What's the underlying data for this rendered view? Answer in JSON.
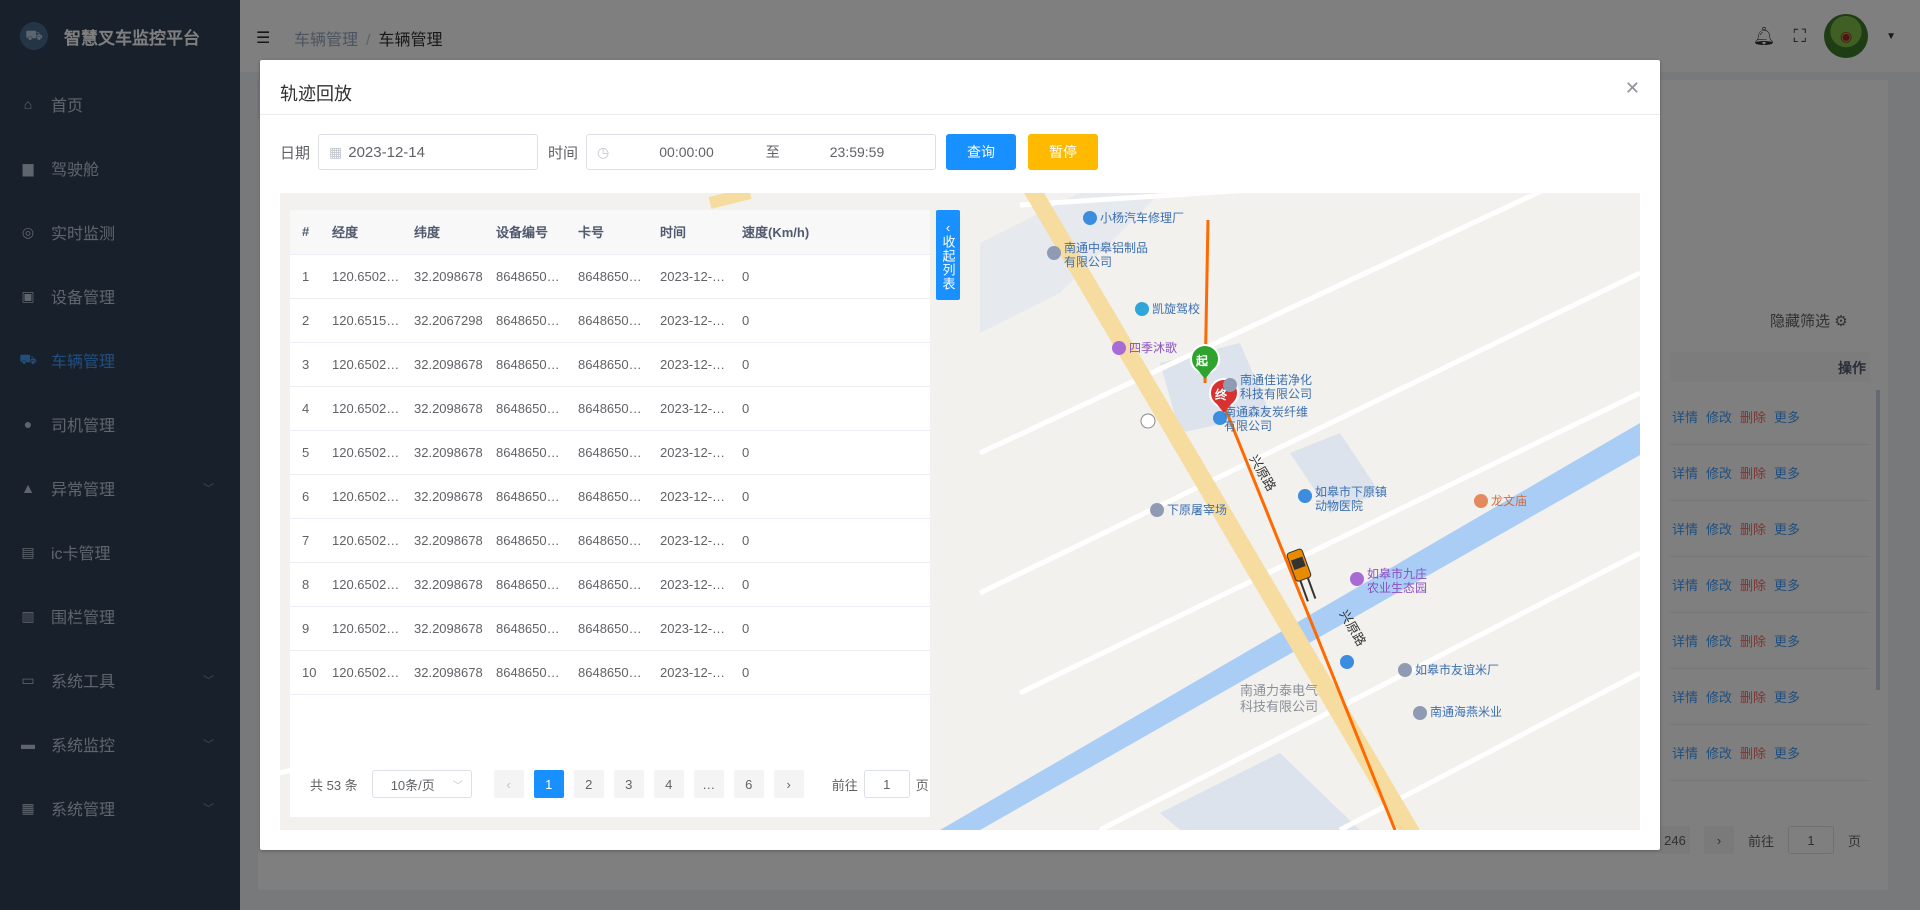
{
  "app": {
    "title": "智慧叉车监控平台"
  },
  "sidebar": {
    "items": [
      {
        "label": "首页",
        "icon": "home-icon"
      },
      {
        "label": "驾驶舱",
        "icon": "monitor-icon"
      },
      {
        "label": "实时监测",
        "icon": "target-icon"
      },
      {
        "label": "设备管理",
        "icon": "image-icon"
      },
      {
        "label": "车辆管理",
        "icon": "truck-icon",
        "active": true
      },
      {
        "label": "司机管理",
        "icon": "user-icon"
      },
      {
        "label": "异常管理",
        "icon": "warning-icon",
        "expandable": true
      },
      {
        "label": "ic卡管理",
        "icon": "card-icon"
      },
      {
        "label": "围栏管理",
        "icon": "fence-icon"
      },
      {
        "label": "系统工具",
        "icon": "toolbox-icon",
        "expandable": true
      },
      {
        "label": "系统监控",
        "icon": "screen-icon",
        "expandable": true
      },
      {
        "label": "系统管理",
        "icon": "grid-icon",
        "expandable": true
      }
    ]
  },
  "header": {
    "breadcrumb": [
      "车辆管理",
      "车辆管理"
    ]
  },
  "background": {
    "hide_filter": "隐藏筛选",
    "op_header": "操作",
    "row_actions": {
      "detail": "详情",
      "edit": "修改",
      "delete": "删除",
      "more": "更多"
    },
    "pager": {
      "last_page": "246",
      "goto_prefix": "前往",
      "goto_value": "1",
      "goto_suffix": "页"
    }
  },
  "dialog": {
    "title": "轨迹回放",
    "query": {
      "date_label": "日期",
      "date_value": "2023-12-14",
      "time_label": "时间",
      "time_start": "00:00:00",
      "time_sep": "至",
      "time_end": "23:59:59",
      "search_button": "查询",
      "pause_button": "暂停"
    },
    "table": {
      "columns": [
        "#",
        "经度",
        "纬度",
        "设备编号",
        "卡号",
        "时间",
        "速度(Km/h)"
      ],
      "rows": [
        [
          "1",
          "120.6502…",
          "32.2098678",
          "86486506…",
          "86486506…",
          "2023-12-1…",
          "0"
        ],
        [
          "2",
          "120.6515…",
          "32.2067298",
          "86486506…",
          "86486506…",
          "2023-12-1…",
          "0"
        ],
        [
          "3",
          "120.6502…",
          "32.2098678",
          "86486506…",
          "86486506…",
          "2023-12-1…",
          "0"
        ],
        [
          "4",
          "120.6502…",
          "32.2098678",
          "86486506…",
          "86486506…",
          "2023-12-1…",
          "0"
        ],
        [
          "5",
          "120.6502…",
          "32.2098678",
          "86486506…",
          "86486506…",
          "2023-12-1…",
          "0"
        ],
        [
          "6",
          "120.6502…",
          "32.2098678",
          "86486506…",
          "86486506…",
          "2023-12-1…",
          "0"
        ],
        [
          "7",
          "120.6502…",
          "32.2098678",
          "86486506…",
          "86486506…",
          "2023-12-1…",
          "0"
        ],
        [
          "8",
          "120.6502…",
          "32.2098678",
          "86486506…",
          "86486506…",
          "2023-12-1…",
          "0"
        ],
        [
          "9",
          "120.6502…",
          "32.2098678",
          "86486506…",
          "86486506…",
          "2023-12-1…",
          "0"
        ],
        [
          "10",
          "120.6502…",
          "32.2098678",
          "86486506…",
          "86486506…",
          "2023-12-1…",
          "0"
        ]
      ]
    },
    "pager": {
      "total": "共 53 条",
      "page_size": "10条/页",
      "pages": [
        "1",
        "2",
        "3",
        "4",
        "…",
        "6"
      ],
      "current": "1",
      "goto_prefix": "前往",
      "goto_value": "1",
      "goto_suffix": "页"
    },
    "collapse_label": "收起列表",
    "map": {
      "markers": {
        "start": "起",
        "end": "终"
      },
      "labels": {
        "l1": "小杨汽车修理厂",
        "l2a": "南通中皋铝制品",
        "l2b": "有限公司",
        "l3": "凯旋驾校",
        "l4": "四季沐歌",
        "l5a": "南通佳诺净化",
        "l5b": "科技有限公司",
        "l6a": "南通森友炭纤维",
        "l6b": "有限公司",
        "l7a": "如皋市下原镇",
        "l7b": "动物医院",
        "l8": "下原屠宰场",
        "l9": "龙文庙",
        "l10a": "如皋市九庄",
        "l10b": "农业生态园",
        "l11": "如皋市友谊米厂",
        "l12a": "南通力泰电气",
        "l12b": "科技有限公司",
        "l13": "南通海燕米业",
        "road1": "兴原路",
        "road2": "兴原路"
      }
    }
  },
  "colors": {
    "sidebar_bg": "#304156",
    "accent": "#1890ff",
    "warning": "#ffba00",
    "track": "#ff6a00",
    "danger": "#f56c6c"
  }
}
